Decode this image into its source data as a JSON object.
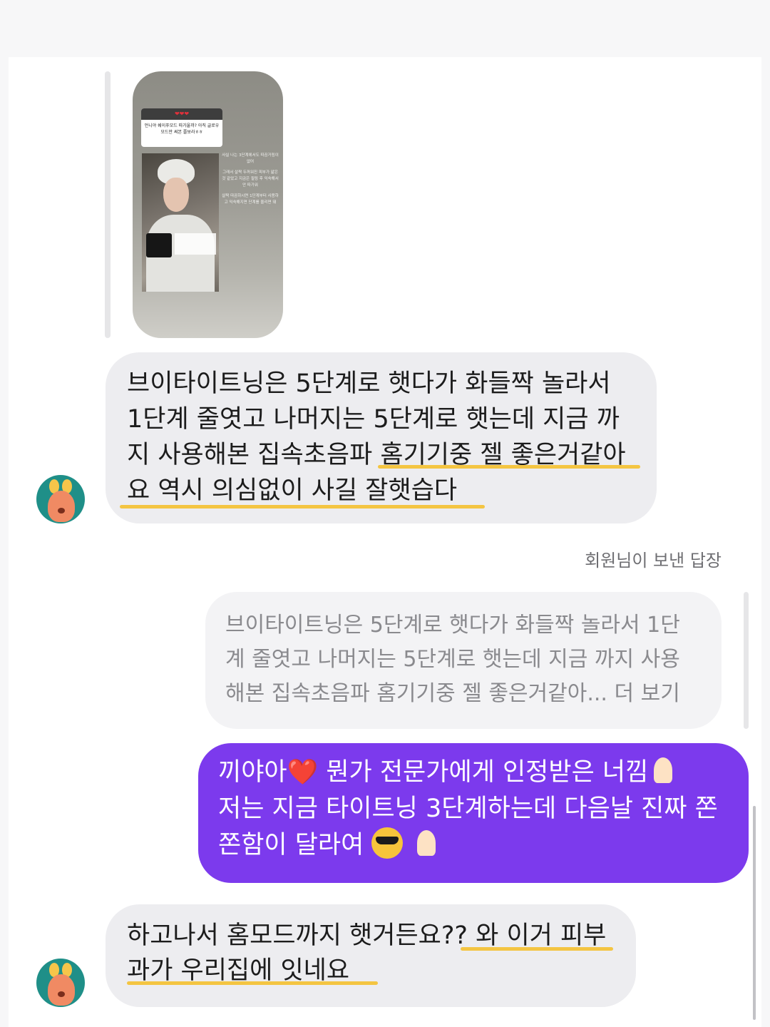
{
  "story": {
    "hearts": "❤❤❤",
    "question": "언니야 쉐이푸모드 따가울까? 아직 글로우모드만 써본 쫄보라ㅎㅎ",
    "side_text": [
      "사실 나는 3단계에서도 따끔거림이 없어",
      "그래서 살짝 두꺼워진 피부가 얇은 것 같았고 지금은 필링 후 익숙해서 안 따가워",
      "살짝 따끔하시면 1단계부터 사용하고 익숙해지면 단계를 올리면 돼"
    ]
  },
  "messages": {
    "received_1": {
      "text": "브이타이트닝은 5단계로 햇다가 화들짝 놀라서 1단계 줄엿고 나머지는 5단계로 햇는데 지금 까지 사용해본 집속초음파 홈기기중 젤 좋은거같아요 역시 의심없이 사길 잘햇습다",
      "lines": [
        "브이타이트닝은 5단계로 햇다가 화들짝 놀라서",
        "1단계 줄엿고 나머지는 5단계로 햇는데 지금 까",
        "지 사용해본 집속초음파 홈기기중 젤 좋은거같아",
        "요 역시 의심없이 사길 잘햇습다"
      ]
    },
    "reply_label": "회원님이 보낸 답장",
    "quoted": {
      "lines": [
        "브이타이트닝은 5단계로 햇다가 화들짝 놀라서 1단",
        "계 줄엿고 나머지는 5단계로 햇는데 지금 까지 사용",
        "해본 집속초음파 홈기기중 젤 좋은거같아... 더 보기"
      ]
    },
    "sent": {
      "line1_a": "끼야아",
      "heart": "❤️",
      "line1_b": " 뭔가 전문가에게 인정받은 너낌",
      "line2": "저는 지금 타이트닝 3단계하는데 다음날 진짜 쫀",
      "line3": "쫀함이 달라여 "
    },
    "received_2": {
      "lines": [
        "하고나서 홈모드까지 햇거든요?? 와 이거 피부",
        "과가 우리집에 잇네요"
      ]
    }
  },
  "colors": {
    "sent_bubble": "#7c3aed",
    "received_bubble": "#ededf0",
    "highlight_underline": "#f4c542",
    "avatar_bg": "#1f8f88"
  }
}
